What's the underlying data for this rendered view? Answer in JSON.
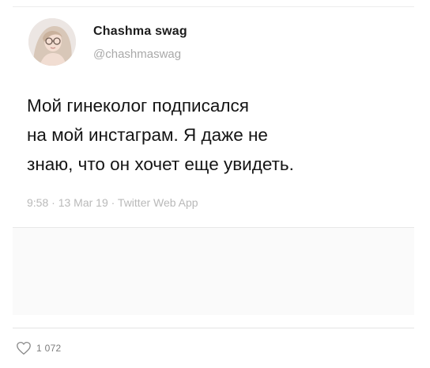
{
  "tweet": {
    "display_name": "Chashma swag",
    "handle": "@chashmaswag",
    "text_lines": [
      "Мой гинеколог подписался",
      "на мой инстаграм. Я даже не",
      "знаю, что он хочет еще увидеть."
    ],
    "meta": "9:58 · 13 Mar 19 · Twitter Web App"
  },
  "post": {
    "like_count": "1 072"
  },
  "icons": {
    "avatar": "avatar-photo",
    "like": "heart-outline-icon"
  },
  "colors": {
    "name": "#1c1c1c",
    "handle": "#a9a9a9",
    "meta": "#b9b9b9",
    "text": "#141414"
  }
}
